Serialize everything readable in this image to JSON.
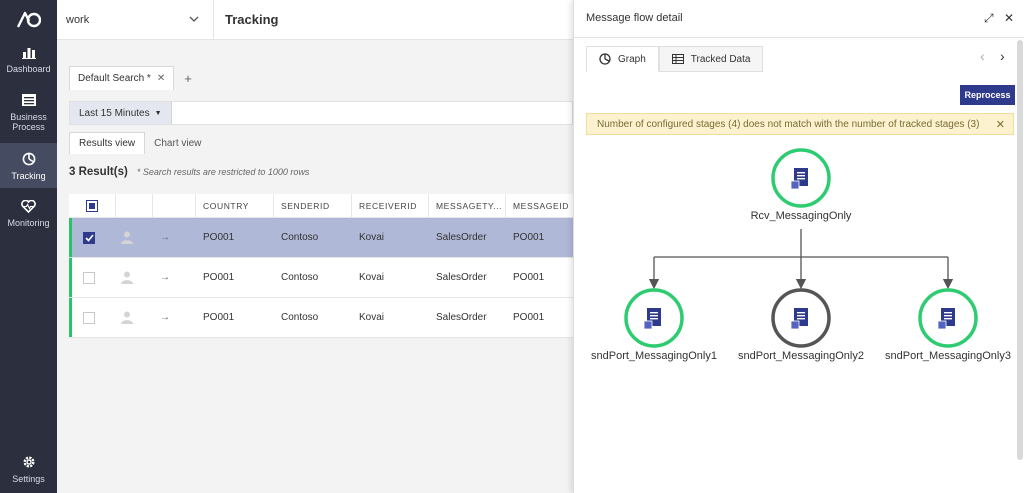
{
  "nav": {
    "items": [
      {
        "label": "Dashboard",
        "icon": "bar-chart-icon"
      },
      {
        "label": "Business Process",
        "icon": "list-icon"
      },
      {
        "label": "Tracking",
        "icon": "pie-icon"
      },
      {
        "label": "Monitoring",
        "icon": "heart-icon"
      },
      {
        "label": "Settings",
        "icon": "gear-icon"
      }
    ]
  },
  "header": {
    "workspace": "work",
    "title": "Tracking"
  },
  "search_tab": {
    "label": "Default Search *"
  },
  "filter": {
    "time_range": "Last 15 Minutes"
  },
  "view_tabs": [
    "Results view",
    "Chart view"
  ],
  "results": {
    "count": "3 Result(s)",
    "note": "* Search results are restricted to 1000 rows"
  },
  "table": {
    "columns": [
      "COUNTRY",
      "SENDERID",
      "RECEIVERID",
      "MESSAGETY...",
      "MESSAGEID"
    ],
    "rows": [
      [
        "PO001",
        "Contoso",
        "Kovai",
        "SalesOrder",
        "PO001"
      ],
      [
        "PO001",
        "Contoso",
        "Kovai",
        "SalesOrder",
        "PO001"
      ],
      [
        "PO001",
        "Contoso",
        "Kovai",
        "SalesOrder",
        "PO001"
      ]
    ]
  },
  "panel": {
    "title": "Message flow detail",
    "tabs": [
      "Graph",
      "Tracked Data"
    ],
    "reprocess": "Reprocess",
    "warning": "Number of configured stages (4) does not match with the number of tracked stages (3)",
    "nodes": [
      {
        "label": "Rcv_MessagingOnly",
        "status": "tracked"
      },
      {
        "label": "sndPort_MessagingOnly1",
        "status": "tracked"
      },
      {
        "label": "sndPort_MessagingOnly2",
        "status": "untracked"
      },
      {
        "label": "sndPort_MessagingOnly3",
        "status": "tracked"
      }
    ]
  },
  "colors": {
    "nav_bg": "#2b2f3e",
    "accent": "#2e3a8c",
    "success": "#29c36a",
    "selected_row": "#b0b8d8",
    "warning_bg": "#fdf2d0"
  }
}
